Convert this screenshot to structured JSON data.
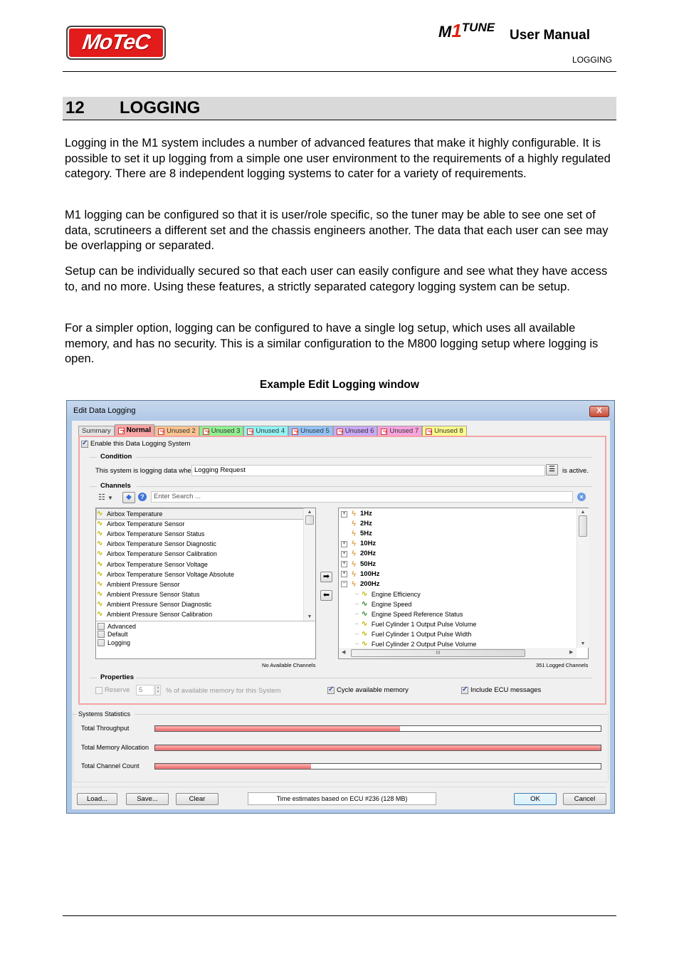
{
  "header": {
    "brand_logo": "MoTeC",
    "product_logo_m": "M",
    "product_logo_one": "1",
    "product_logo_tune": "TUNE",
    "doc_title": "User Manual",
    "section_tag": "LOGGING"
  },
  "section": {
    "number": "12",
    "title": "LOGGING"
  },
  "paragraphs": [
    "Logging in the M1 system includes a number of advanced features that make it highly configurable. It is possible to set it up logging from a simple one user environment to the requirements of a highly regulated category. There are 8 independent logging systems to cater for a variety of requirements.",
    "M1 logging can be configured so that it is user/role specific, so the tuner may be able to see one set of data, scrutineers a different set and the chassis engineers another. The data that each user can see may be overlapping or separated.",
    "Setup can be individually secured so that each user can easily configure and see what they have access to, and no more. Using these features, a strictly separated category logging system can be setup.",
    "For a simpler option, logging can be configured to have a single log setup, which uses all available memory, and has no security. This is a similar configuration to the M800 logging setup where logging is open."
  ],
  "figure_caption": "Example Edit Logging window",
  "dialog": {
    "title": "Edit Data Logging",
    "close_label": "X",
    "tabs": [
      {
        "label": "Summary",
        "color": "#e4e4e4",
        "active": false,
        "icon": false
      },
      {
        "label": "Normal",
        "color": "#f9a5a5",
        "active": true,
        "icon": true
      },
      {
        "label": "Unused 2",
        "color": "#fbc48f",
        "active": false,
        "icon": true
      },
      {
        "label": "Unused 3",
        "color": "#8ff08f",
        "active": false,
        "icon": true
      },
      {
        "label": "Unused 4",
        "color": "#92f4f4",
        "active": false,
        "icon": true
      },
      {
        "label": "Unused 5",
        "color": "#92c4f8",
        "active": false,
        "icon": true
      },
      {
        "label": "Unused 6",
        "color": "#c9a8f8",
        "active": false,
        "icon": true
      },
      {
        "label": "Unused 7",
        "color": "#f8a4e0",
        "active": false,
        "icon": true
      },
      {
        "label": "Unused 8",
        "color": "#fcfc8c",
        "active": false,
        "icon": true
      }
    ],
    "enable_label": "Enable this Data Logging System",
    "enable_checked": true,
    "condition": {
      "group_label": "Condition",
      "prefix": "This system is logging data when",
      "value": "Logging Request",
      "suffix": "is active."
    },
    "channels": {
      "group_label": "Channels",
      "search_placeholder": "Enter Search ...",
      "available": [
        "Airbox Temperature",
        "Airbox Temperature Sensor",
        "Airbox Temperature Sensor Status",
        "Airbox Temperature Sensor Diagnostic",
        "Airbox Temperature Sensor Calibration",
        "Airbox Temperature Sensor Voltage",
        "Airbox Temperature Sensor Voltage Absolute",
        "Ambient Pressure Sensor",
        "Ambient Pressure Sensor Status",
        "Ambient Pressure Sensor Diagnostic",
        "Ambient Pressure Sensor Calibration"
      ],
      "filters": [
        {
          "label": "Advanced",
          "checked": false
        },
        {
          "label": "Default",
          "checked": false
        },
        {
          "label": "Logging",
          "checked": false
        }
      ],
      "available_status": "No Available Channels",
      "logged_tree": [
        {
          "label": "1Hz",
          "expander": "+",
          "type": "rate"
        },
        {
          "label": "2Hz",
          "expander": "",
          "type": "rate"
        },
        {
          "label": "5Hz",
          "expander": "",
          "type": "rate"
        },
        {
          "label": "10Hz",
          "expander": "+",
          "type": "rate"
        },
        {
          "label": "20Hz",
          "expander": "+",
          "type": "rate"
        },
        {
          "label": "50Hz",
          "expander": "+",
          "type": "rate"
        },
        {
          "label": "100Hz",
          "expander": "+",
          "type": "rate"
        },
        {
          "label": "200Hz",
          "expander": "-",
          "type": "rate"
        },
        {
          "label": "Engine Efficiency",
          "type": "channel"
        },
        {
          "label": "Engine Speed",
          "type": "channel-special"
        },
        {
          "label": "Engine Speed Reference Status",
          "type": "channel-special"
        },
        {
          "label": "Fuel Cylinder 1 Output Pulse Volume",
          "type": "channel"
        },
        {
          "label": "Fuel Cylinder 1 Output Pulse Width",
          "type": "channel"
        },
        {
          "label": "Fuel Cylinder 2 Output Pulse Volume",
          "type": "channel"
        }
      ],
      "logged_status": "351 Logged Channels",
      "hscroll_grip": "III"
    },
    "properties": {
      "group_label": "Properties",
      "reserve_label": "Reserve",
      "reserve_checked": false,
      "reserve_value": "5",
      "reserve_suffix": "% of available memory for this System",
      "cycle_label": "Cycle available memory",
      "cycle_checked": true,
      "ecu_label": "Include ECU messages",
      "ecu_checked": true
    },
    "statistics": {
      "group_label": "Systems Statistics",
      "rows": [
        {
          "label": "Total Throughput",
          "percent": 55
        },
        {
          "label": "Total Memory Allocation",
          "percent": 100
        },
        {
          "label": "Total Channel Count",
          "percent": 35
        }
      ]
    },
    "footer": {
      "load_label": "Load...",
      "save_label": "Save...",
      "clear_label": "Clear",
      "estimate_text": "Time estimates based on ECU #236 (128 MB)",
      "ok_label": "OK",
      "cancel_label": "Cancel"
    }
  }
}
